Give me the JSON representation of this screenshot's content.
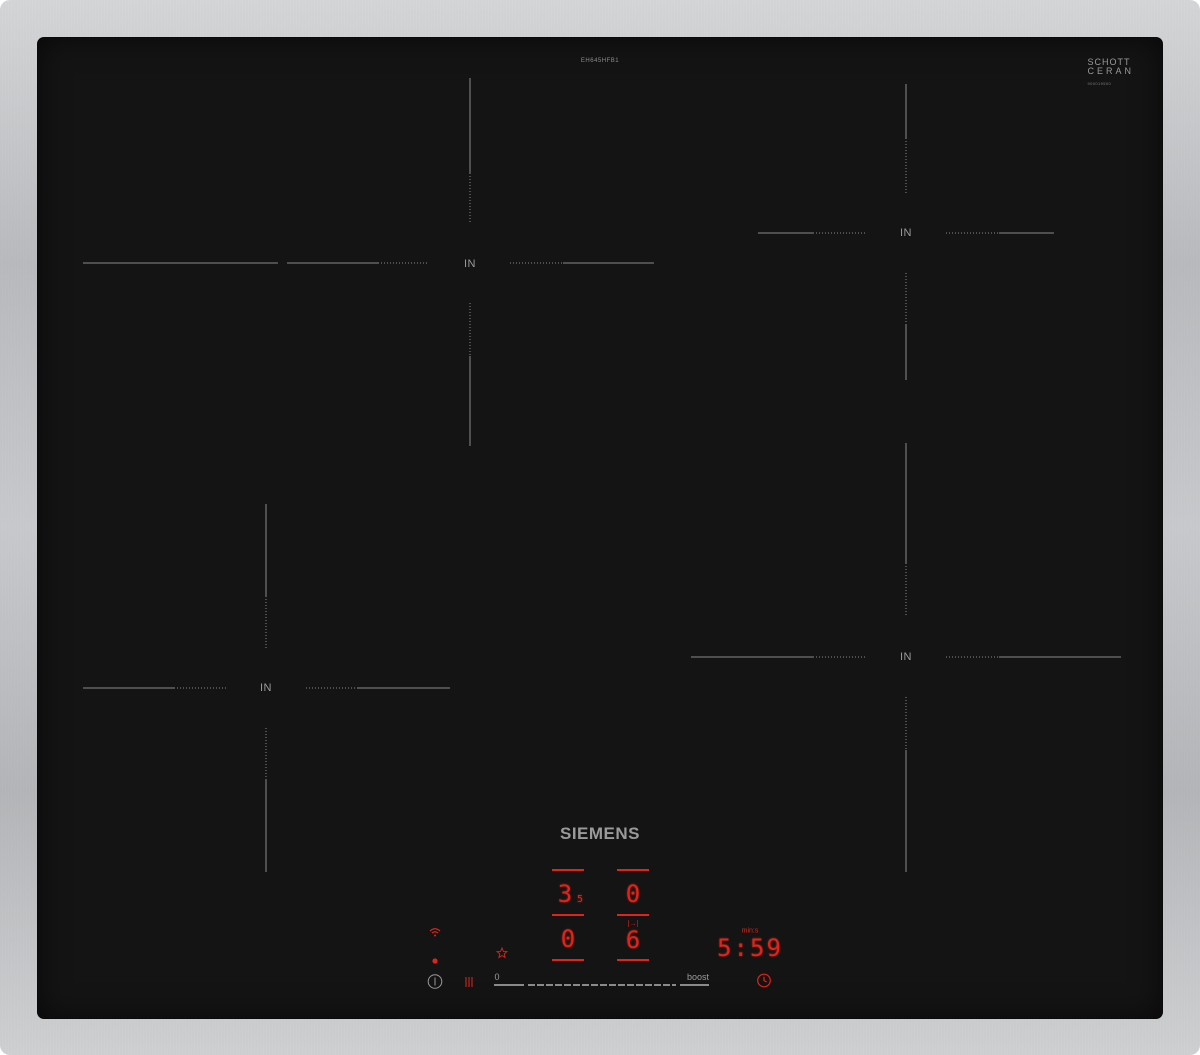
{
  "hob": {
    "model_code": "EH645HFB1",
    "glass_brand": {
      "line1": "SCHOTT",
      "line2": "CERAN",
      "code": "900019500"
    },
    "brand": "SIEMENS",
    "zones": [
      {
        "label": "IN"
      },
      {
        "label": "IN"
      },
      {
        "label": "IN"
      },
      {
        "label": "IN"
      }
    ]
  },
  "control_panel": {
    "zone_displays": {
      "top_left": {
        "value": "3",
        "decimal": "5"
      },
      "top_right": {
        "value": "0"
      },
      "bottom_left": {
        "value": "0"
      },
      "bottom_right": {
        "value": "6",
        "mode_symbol": "|→|"
      }
    },
    "timer": {
      "unit": "min:s",
      "value": "5:59"
    },
    "slider": {
      "start_label": "0",
      "end_label": "boost"
    },
    "icons": {
      "wifi": "wifi-icon",
      "indicator": "red-dot-icon",
      "favourite": "star-icon",
      "power": "power-icon",
      "heat": "heat-icon",
      "timer": "clock-icon"
    },
    "colors": {
      "display": "#e0241b",
      "glass": "#141414",
      "markings": "#9a9a9a"
    }
  }
}
